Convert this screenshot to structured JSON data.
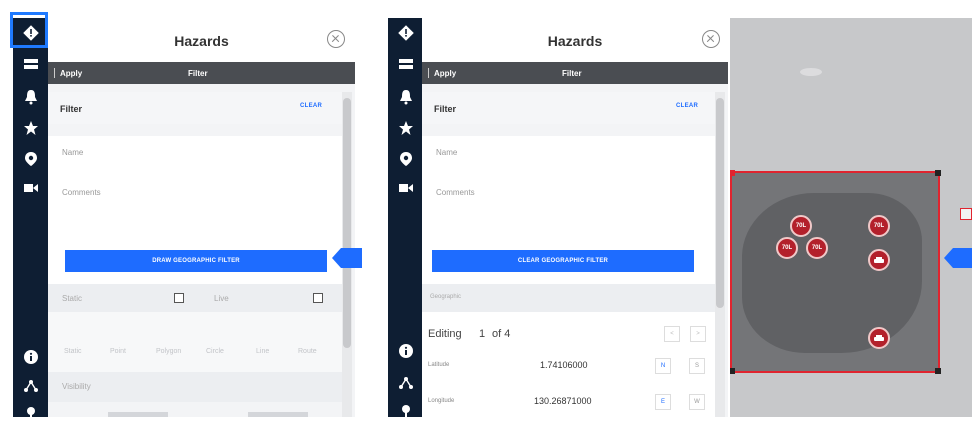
{
  "left_panel": {
    "title": "Hazards",
    "toolbar": {
      "apply_label": "Apply",
      "filter_label": "Filter"
    },
    "filter_header": {
      "label": "Filter",
      "clear_label": "CLEAR"
    },
    "fields": {
      "name_placeholder": "Name",
      "comments_placeholder": "Comments"
    },
    "geo_button_label": "DRAW GEOGRAPHIC FILTER",
    "checkbox_row": {
      "label_a": "Static",
      "label_b": "Live"
    },
    "tabs": [
      "Static",
      "Point",
      "Polygon",
      "Circle",
      "Line",
      "Route"
    ],
    "bottom_label": "Visibility"
  },
  "right_panel": {
    "title": "Hazards",
    "toolbar": {
      "apply_label": "Apply",
      "filter_label": "Filter"
    },
    "filter_header": {
      "label": "Filter",
      "clear_label": "CLEAR"
    },
    "fields": {
      "name_placeholder": "Name",
      "comments_placeholder": "Comments"
    },
    "geo_button_label": "CLEAR GEOGRAPHIC FILTER",
    "geo_label": "Geographic",
    "editing": {
      "label": "Editing",
      "current": "1",
      "of_label": "of 4"
    },
    "latitude": {
      "label": "Latitude",
      "value": "1.74106000",
      "dir_a": "N",
      "dir_b": "S"
    },
    "longitude": {
      "label": "Longitude",
      "value": "130.26871000",
      "dir_a": "E",
      "dir_b": "W"
    }
  },
  "map": {
    "marker_label": "70L",
    "selection_color": "#e0242f",
    "marker_color": "#b3202b"
  },
  "colors": {
    "rail": "#0e1e33",
    "accent": "#1e6cff",
    "toolbar": "#4a4d52"
  }
}
